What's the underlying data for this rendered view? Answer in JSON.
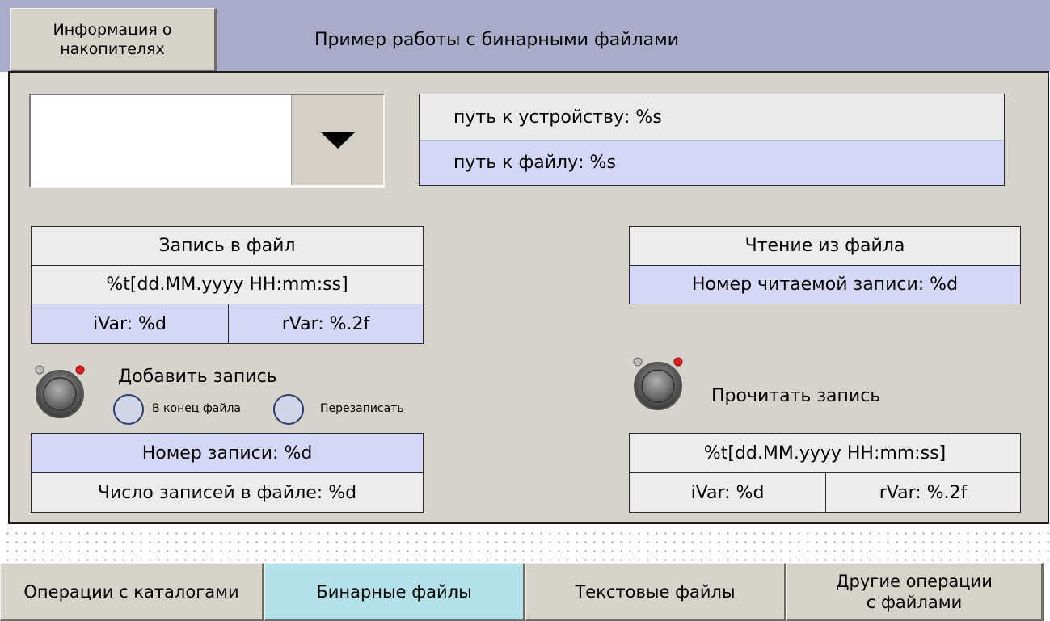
{
  "header": {
    "info_button_label": "Информация о\nнакопителях",
    "title": "Пример работы с бинарными файлами"
  },
  "device_select": {
    "value": "",
    "arrow_icon": "triangle-down"
  },
  "paths": {
    "device_path": "путь к устройству: %s",
    "file_path": "путь к файлу: %s"
  },
  "write_section": {
    "title": "Запись в файл",
    "datetime": "%t[dd.MM.yyyy HH:mm:ss]",
    "ivar": "iVar: %d",
    "rvar": "rVar: %.2f",
    "add_button_label": "Добавить запись",
    "mode_options": [
      "В конец файла",
      "Перезаписать"
    ],
    "record_number": "Номер записи: %d",
    "record_count": "Число записей в файле: %d"
  },
  "read_section": {
    "title": "Чтение из файла",
    "read_record_number": "Номер читаемой записи: %d",
    "read_button_label": "Прочитать запись",
    "datetime": "%t[dd.MM.yyyy HH:mm:ss]",
    "ivar": "iVar: %d",
    "rvar": "rVar: %.2f"
  },
  "nav_tabs": [
    {
      "label": "Операции с каталогами",
      "active": false
    },
    {
      "label": "Бинарные файлы",
      "active": true
    },
    {
      "label": "Текстовые файлы",
      "active": false
    },
    {
      "label": "Другие операции\nс файлами",
      "active": false
    }
  ],
  "colors": {
    "header_bg": "#a9abc8",
    "panel_bg": "#d6d3cd",
    "highlight_cell": "#d5d7f6",
    "active_tab": "#b4e0e8",
    "button_led": "#e21b22"
  }
}
